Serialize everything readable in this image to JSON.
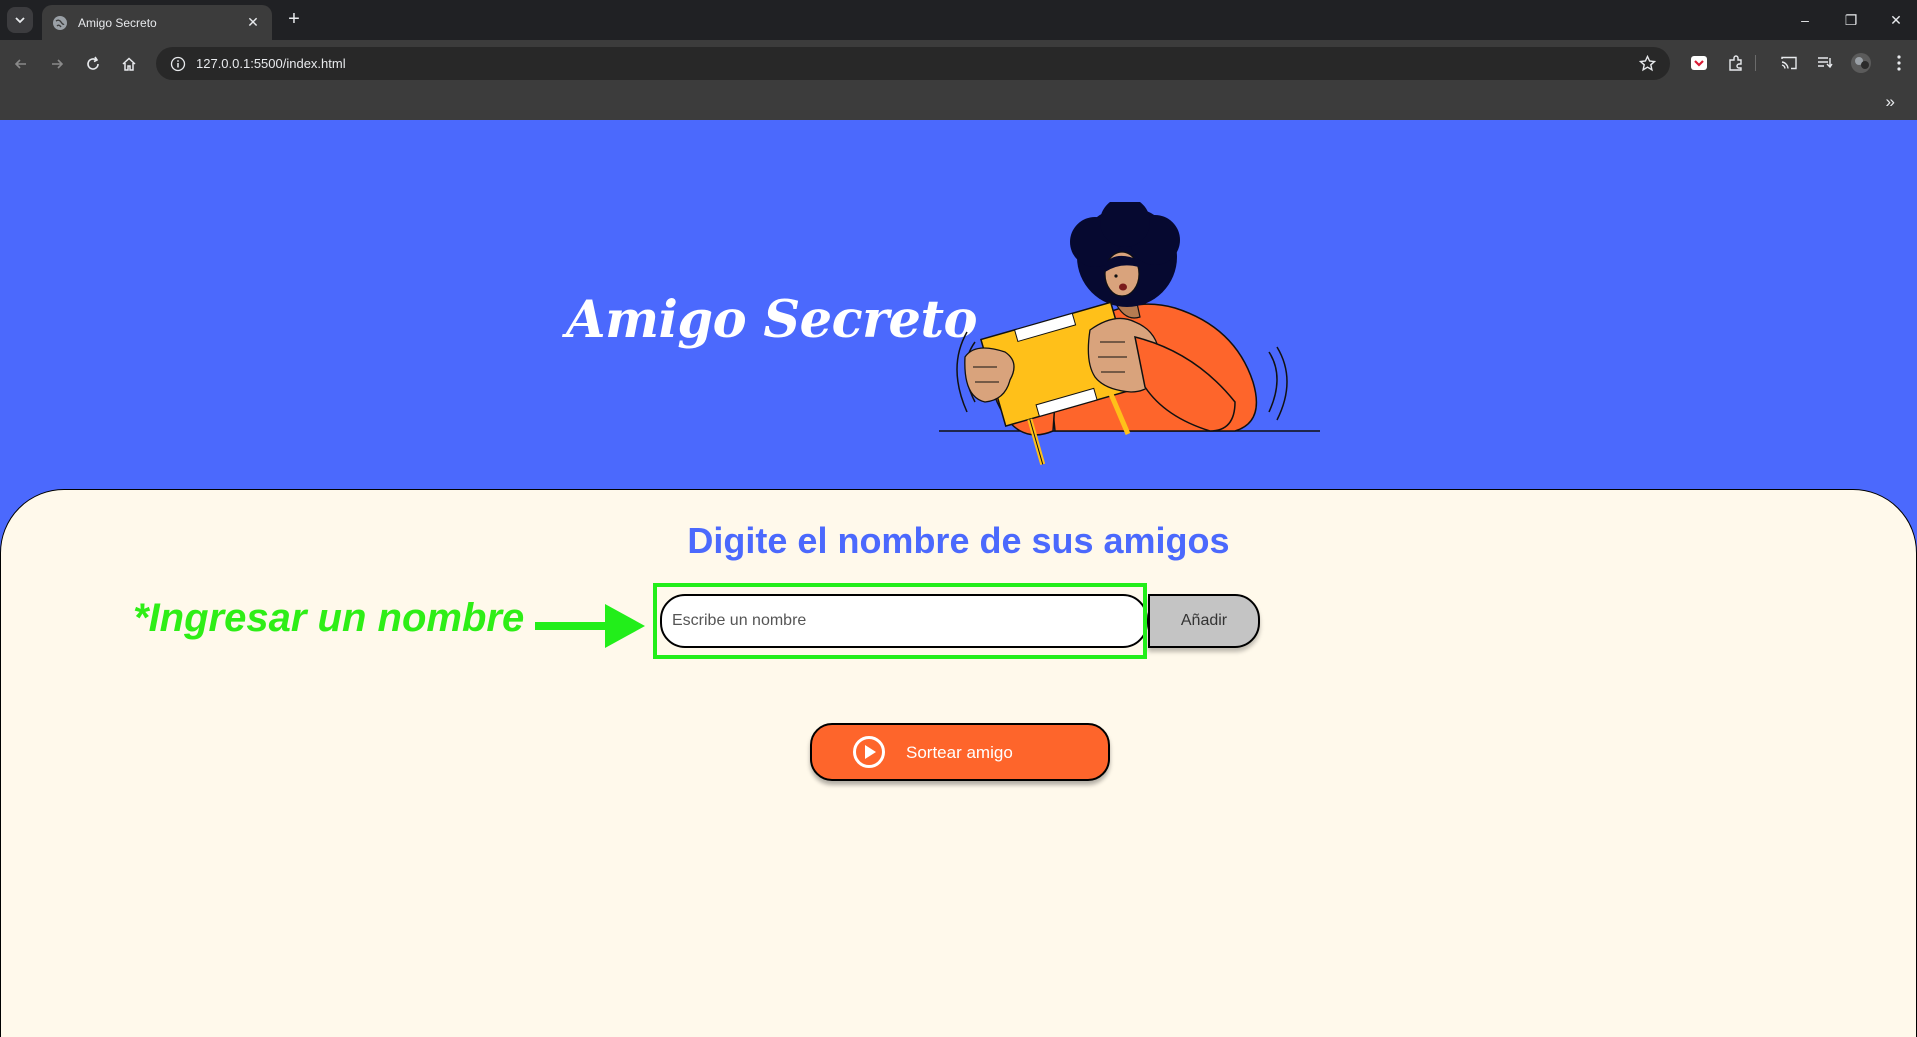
{
  "browser": {
    "tab_title": "Amigo Secreto",
    "url": "127.0.0.1:5500/index.html",
    "new_tab_label": "+",
    "minimize_label": "–",
    "restore_label": "❐",
    "close_label": "✕",
    "bookmarks_more_label": "»"
  },
  "page": {
    "banner_title": "Amigo Secreto",
    "subtitle": "Digite el nombre de sus amigos",
    "input_placeholder": "Escribe un nombre",
    "add_button_label": "Añadir",
    "draw_button_label": "Sortear amigo",
    "illustration_icon": "person-opening-gift-illustration"
  },
  "annotation": {
    "text": "*Ingresar un nombre",
    "color": "#22ee1a"
  },
  "colors": {
    "primary": "#4b69fd",
    "card_background": "#fff9eb",
    "accent_orange": "#fe652b",
    "add_button_gray": "#c4c4c4"
  }
}
